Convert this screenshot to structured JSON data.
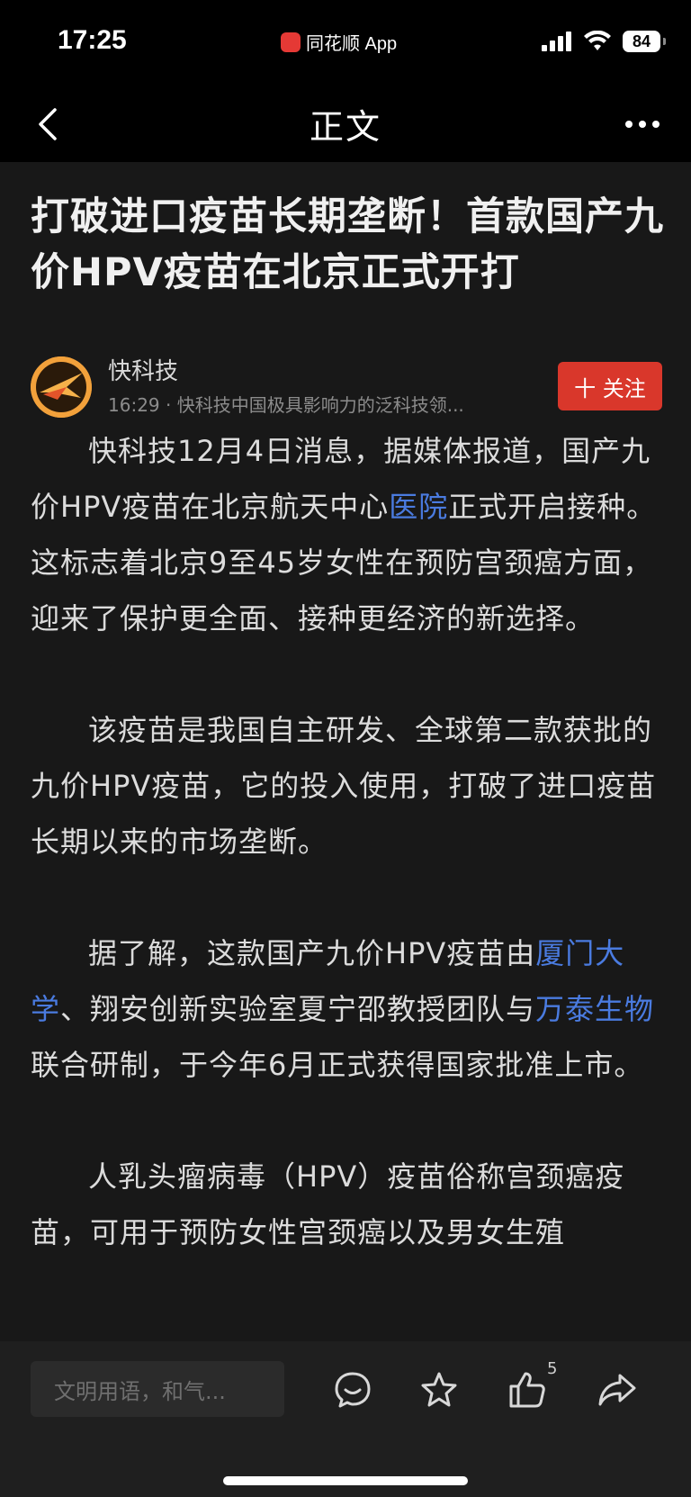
{
  "status_bar": {
    "time": "17:25",
    "app_name": "同花顺 App",
    "battery": "84"
  },
  "nav": {
    "title": "正文",
    "back_icon": "chevron-left-icon",
    "more_icon": "more-dots-icon"
  },
  "article": {
    "headline": "打破进口疫苗长期垄断！首款国产九价HPV疫苗在北京正式开打",
    "author": {
      "name": "快科技",
      "meta": "16:29 · 快科技中国极具影响力的泛科技领..."
    },
    "follow_label": "十 关注",
    "paragraphs": [
      {
        "part1": "快科技12月4日消息，据媒体报道，国产九价HPV疫苗在北京航天中心",
        "link1": "医院",
        "part2": "正式开启接种。这标志着北京9至45岁女性在预防宫颈癌方面，迎来了保护更全面、接种更经济的新选择。"
      },
      {
        "text": "该疫苗是我国自主研发、全球第二款获批的九价HPV疫苗，它的投入使用，打破了进口疫苗长期以来的市场垄断。"
      },
      {
        "part1": "据了解，这款国产九价HPV疫苗由",
        "link1": "厦门大学",
        "part2": "、翔安创新实验室夏宁邵教授团队与",
        "link2": "万泰生物",
        "part3": "联合研制，于今年6月正式获得国家批准上市。"
      },
      {
        "text": "人乳头瘤病毒（HPV）疫苗俗称宫颈癌疫苗，可用于预防女性宫颈癌以及男女生殖"
      }
    ]
  },
  "bottom_bar": {
    "comment_placeholder": "文明用语，和气...",
    "like_count": "5",
    "icons": [
      "comment-icon",
      "star-icon",
      "thumbs-up-icon",
      "share-icon"
    ]
  },
  "colors": {
    "accent_red": "#d9372b",
    "link_blue": "#4a7be0",
    "background": "#181818"
  }
}
